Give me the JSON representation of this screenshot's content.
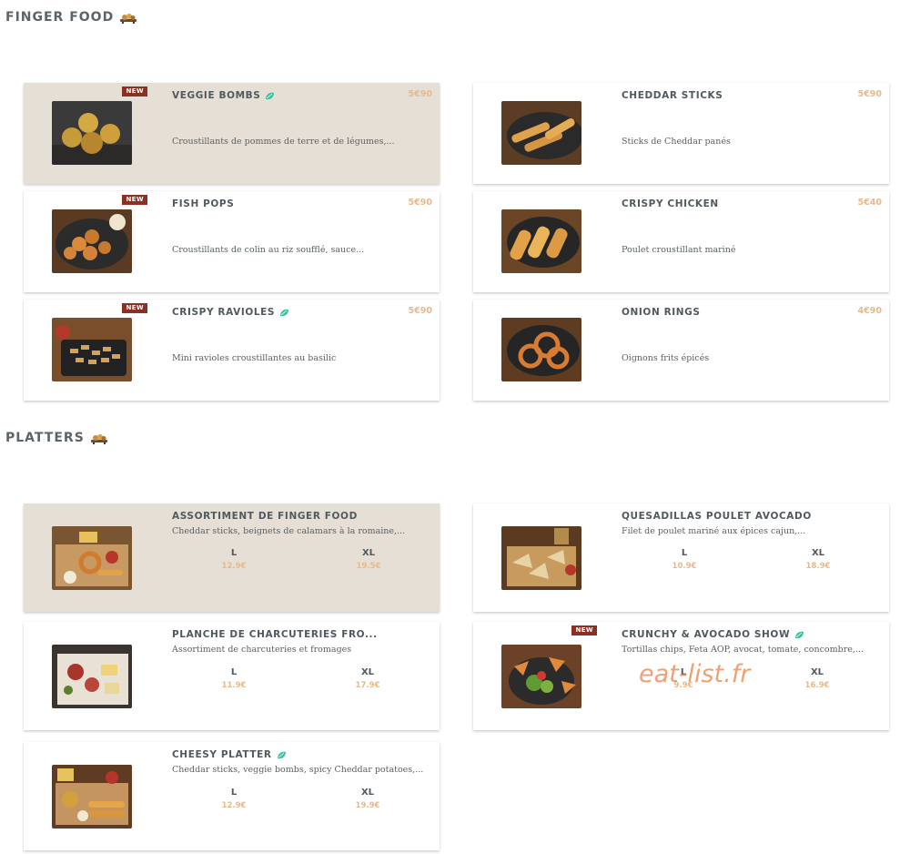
{
  "sections": {
    "finger_food": {
      "title": "FINGER FOOD"
    },
    "platters": {
      "title": "PLATTERS"
    }
  },
  "badge_label": "NEW",
  "finger_food_items": [
    {
      "name": "VEGGIE BOMBS",
      "price": "5€90",
      "desc": "Croustillants de pommes de terre et de légumes,...",
      "badge": true,
      "veggie": true
    },
    {
      "name": "CHEDDAR STICKS",
      "price": "5€90",
      "desc": "Sticks de Cheddar panés",
      "badge": false,
      "veggie": false
    },
    {
      "name": "FISH POPS",
      "price": "5€90",
      "desc": "Croustillants de colin au riz soufflé, sauce...",
      "badge": true,
      "veggie": false
    },
    {
      "name": "CRISPY CHICKEN",
      "price": "5€40",
      "desc": "Poulet croustillant mariné",
      "badge": false,
      "veggie": false
    },
    {
      "name": "CRISPY RAVIOLES",
      "price": "5€90",
      "desc": "Mini ravioles croustillantes au basilic",
      "badge": true,
      "veggie": true
    },
    {
      "name": "ONION RINGS",
      "price": "4€90",
      "desc": "Oignons frits épicés",
      "badge": false,
      "veggie": false
    }
  ],
  "platter_items": [
    {
      "name": "ASSORTIMENT DE FINGER FOOD",
      "desc": "Cheddar sticks, beignets de calamars à la romaine,...",
      "sizes": [
        {
          "label": "L",
          "price": "12.9€"
        },
        {
          "label": "XL",
          "price": "19.5€"
        }
      ],
      "badge": false,
      "veggie": false
    },
    {
      "name": "QUESADILLAS POULET AVOCADO",
      "desc": "Filet de poulet mariné aux épices cajun,...",
      "sizes": [
        {
          "label": "L",
          "price": "10.9€"
        },
        {
          "label": "XL",
          "price": "18.9€"
        }
      ],
      "badge": false,
      "veggie": false
    },
    {
      "name": "PLANCHE DE CHARCUTERIES FRO...",
      "desc": "Assortiment de charcuteries et fromages",
      "sizes": [
        {
          "label": "L",
          "price": "11.9€"
        },
        {
          "label": "XL",
          "price": "17.9€"
        }
      ],
      "badge": false,
      "veggie": false
    },
    {
      "name": "CRUNCHY & AVOCADO SHOW",
      "desc": "Tortillas chips, Feta AOP, avocat, tomate, concombre,...",
      "sizes": [
        {
          "label": "L",
          "price": "9.9€"
        },
        {
          "label": "XL",
          "price": "16.9€"
        }
      ],
      "badge": true,
      "veggie": true
    },
    {
      "name": "CHEESY PLATTER",
      "desc": "Cheddar sticks, veggie bombs, spicy Cheddar potatoes,...",
      "sizes": [
        {
          "label": "L",
          "price": "12.9€"
        },
        {
          "label": "XL",
          "price": "19.9€"
        }
      ],
      "badge": false,
      "veggie": true
    }
  ],
  "watermark": "eat-list.fr",
  "colors": {
    "price": "#e8b98a",
    "badge": "#8e2f24",
    "highlight_card": "#e5dfd5",
    "veggie_leaf": "#3fbf9f",
    "title": "#5b6468"
  },
  "icons": {
    "category": "food-tray-icon",
    "veggie": "leaf-icon"
  }
}
